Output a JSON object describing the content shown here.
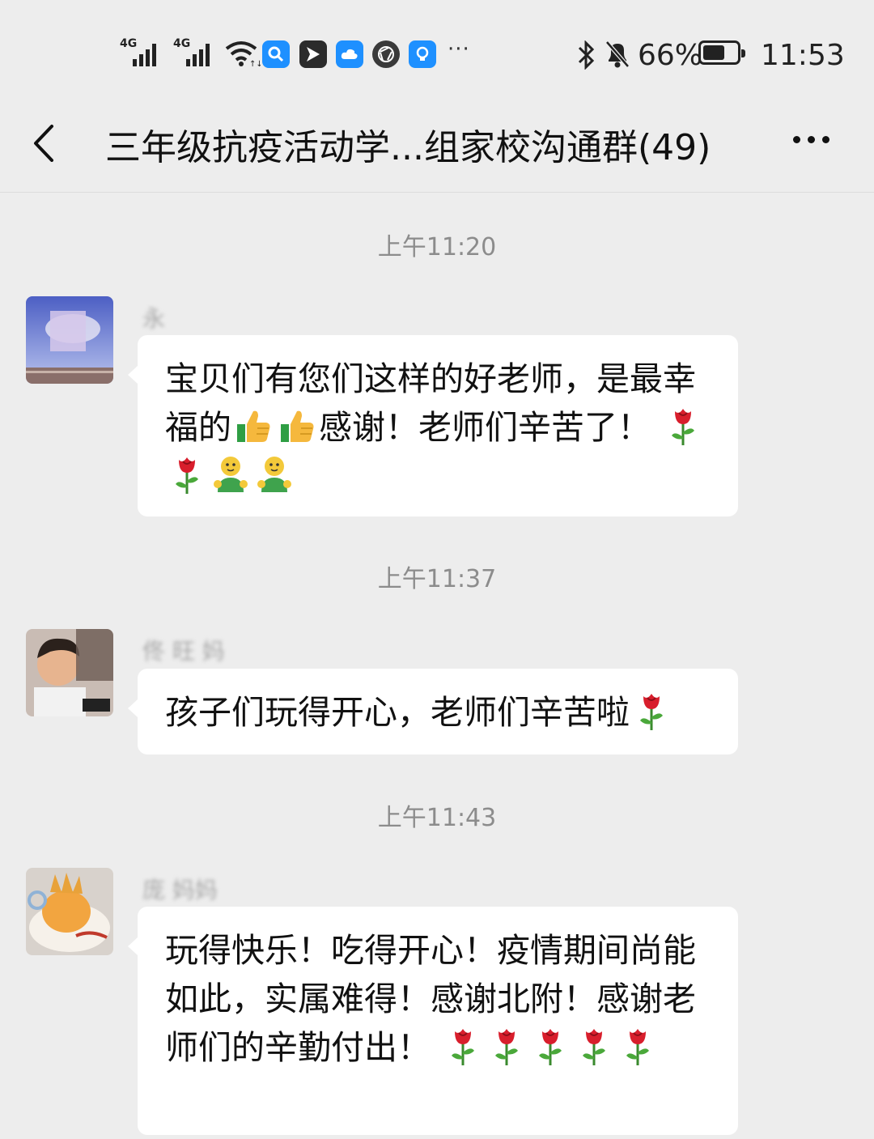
{
  "status_bar": {
    "signal_1_label": "4G",
    "signal_2_label": "4G",
    "wifi_icon": "wifi-icon",
    "notification_icons": [
      "search-app-icon",
      "paper-plane-app-icon",
      "cloud-app-icon",
      "aperture-app-icon",
      "lightbulb-app-icon"
    ],
    "more_notifications": "···",
    "battery_percent": "66%",
    "battery_level": 0.66,
    "time": "11:53"
  },
  "header": {
    "title": "三年级抗疫活动学...组家校沟通群(49)"
  },
  "messages": [
    {
      "timestamp": "上午11:20",
      "sender": "永",
      "parts": [
        {
          "t": "宝贝们有您们这样的好老师，是最幸福的"
        },
        {
          "e": "thumbs-up"
        },
        {
          "e": "thumbs-up"
        },
        {
          "t": "感谢！老师们辛苦了！"
        },
        {
          "t": " "
        },
        {
          "e": "rose"
        },
        {
          "e": "rose"
        },
        {
          "e": "hug"
        },
        {
          "e": "hug"
        }
      ]
    },
    {
      "timestamp": "上午11:37",
      "sender": "佟 旺 妈",
      "parts": [
        {
          "t": "孩子们玩得开心，老师们辛苦啦"
        },
        {
          "e": "rose"
        }
      ]
    },
    {
      "timestamp": "上午11:43",
      "sender": "庞 妈妈",
      "parts": [
        {
          "t": "玩得快乐！吃得开心！疫情期间尚能如此，实属难得！感谢北附！感谢老师们的辛勤付出！"
        },
        {
          "t": " "
        },
        {
          "e": "rose"
        },
        {
          "e": "rose"
        },
        {
          "e": "rose"
        },
        {
          "e": "rose"
        },
        {
          "e": "rose"
        }
      ]
    }
  ],
  "colors": {
    "background": "#ededed",
    "bubble": "#ffffff",
    "timestamp_text": "#8c8c8c",
    "notification_blue": "#1e90ff"
  }
}
